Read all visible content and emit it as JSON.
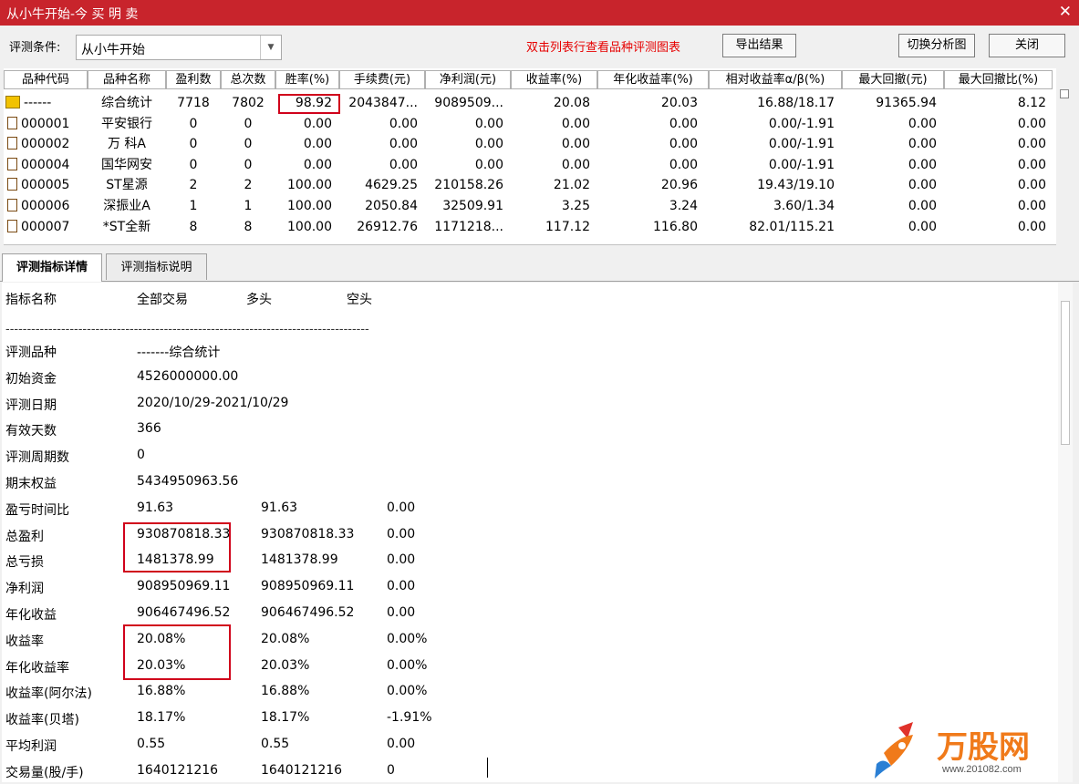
{
  "window": {
    "title": "从小牛开始-今 买 明 卖",
    "close_glyph": "✕"
  },
  "toolbar": {
    "condition_label": "评测条件:",
    "condition_value": "从小牛开始",
    "hint": "双击列表行查看品种评测图表",
    "export_label": "导出结果",
    "switch_label": "切换分析图",
    "close_label": "关闭"
  },
  "grid": {
    "columns": [
      "品种代码",
      "品种名称",
      "盈利数",
      "总次数",
      "胜率(%)",
      "手续费(元)",
      "净利润(元)",
      "收益率(%)",
      "年化收益率(%)",
      "相对收益率α/β(%)",
      "最大回撤(元)",
      "最大回撤比(%)"
    ],
    "rows": [
      {
        "code": "------",
        "name": "综合统计",
        "win": "7718",
        "total": "7802",
        "rate": "98.92",
        "fee": "2043847...",
        "profit": "9089509...",
        "ret": "20.08",
        "annual": "20.03",
        "alpha": "16.88/18.17",
        "dd": "91365.94",
        "ddr": "8.12"
      },
      {
        "code": "000001",
        "name": "平安银行",
        "win": "0",
        "total": "0",
        "rate": "0.00",
        "fee": "0.00",
        "profit": "0.00",
        "ret": "0.00",
        "annual": "0.00",
        "alpha": "0.00/-1.91",
        "dd": "0.00",
        "ddr": "0.00"
      },
      {
        "code": "000002",
        "name": "万 科A",
        "win": "0",
        "total": "0",
        "rate": "0.00",
        "fee": "0.00",
        "profit": "0.00",
        "ret": "0.00",
        "annual": "0.00",
        "alpha": "0.00/-1.91",
        "dd": "0.00",
        "ddr": "0.00"
      },
      {
        "code": "000004",
        "name": "国华网安",
        "win": "0",
        "total": "0",
        "rate": "0.00",
        "fee": "0.00",
        "profit": "0.00",
        "ret": "0.00",
        "annual": "0.00",
        "alpha": "0.00/-1.91",
        "dd": "0.00",
        "ddr": "0.00"
      },
      {
        "code": "000005",
        "name": "ST星源",
        "win": "2",
        "total": "2",
        "rate": "100.00",
        "fee": "4629.25",
        "profit": "210158.26",
        "ret": "21.02",
        "annual": "20.96",
        "alpha": "19.43/19.10",
        "dd": "0.00",
        "ddr": "0.00"
      },
      {
        "code": "000006",
        "name": "深振业A",
        "win": "1",
        "total": "1",
        "rate": "100.00",
        "fee": "2050.84",
        "profit": "32509.91",
        "ret": "3.25",
        "annual": "3.24",
        "alpha": "3.60/1.34",
        "dd": "0.00",
        "ddr": "0.00"
      },
      {
        "code": "000007",
        "name": "*ST全新",
        "win": "8",
        "total": "8",
        "rate": "100.00",
        "fee": "26912.76",
        "profit": "1171218...",
        "ret": "117.12",
        "annual": "116.80",
        "alpha": "82.01/115.21",
        "dd": "0.00",
        "ddr": "0.00"
      }
    ]
  },
  "tabs": [
    "评测指标详情",
    "评测指标说明"
  ],
  "detail": {
    "header": [
      "指标名称",
      "全部交易",
      "多头",
      "空头"
    ],
    "separator": "-------------------------------------------------------------------------------------",
    "rows": [
      {
        "label": "评测品种",
        "v1": "-------综合统计",
        "v2": "",
        "v3": ""
      },
      {
        "label": "初始资金",
        "v1": "4526000000.00",
        "v2": "",
        "v3": ""
      },
      {
        "label": "评测日期",
        "v1": "2020/10/29-2021/10/29",
        "v2": "",
        "v3": ""
      },
      {
        "label": "有效天数",
        "v1": "366",
        "v2": "",
        "v3": ""
      },
      {
        "label": "评测周期数",
        "v1": "0",
        "v2": "",
        "v3": ""
      },
      {
        "label": "期末权益",
        "v1": "5434950963.56",
        "v2": "",
        "v3": ""
      },
      {
        "label": "盈亏时间比",
        "v1": "91.63",
        "v2": "91.63",
        "v3": "0.00"
      },
      {
        "label": "总盈利",
        "v1": "930870818.33",
        "v2": "930870818.33",
        "v3": "0.00"
      },
      {
        "label": "总亏损",
        "v1": "1481378.99",
        "v2": "1481378.99",
        "v3": "0.00"
      },
      {
        "label": "净利润",
        "v1": "908950969.11",
        "v2": "908950969.11",
        "v3": "0.00"
      },
      {
        "label": "年化收益",
        "v1": "906467496.52",
        "v2": "906467496.52",
        "v3": "0.00"
      },
      {
        "label": "收益率",
        "v1": "20.08%",
        "v2": "20.08%",
        "v3": "0.00%"
      },
      {
        "label": "年化收益率",
        "v1": "20.03%",
        "v2": "20.03%",
        "v3": "0.00%"
      },
      {
        "label": "收益率(阿尔法)",
        "v1": "16.88%",
        "v2": "16.88%",
        "v3": "0.00%"
      },
      {
        "label": "收益率(贝塔)",
        "v1": "18.17%",
        "v2": "18.17%",
        "v3": "-1.91%"
      },
      {
        "label": "平均利润",
        "v1": "0.55",
        "v2": "0.55",
        "v3": "0.00"
      },
      {
        "label": "交易量(股/手)",
        "v1": "1640121216",
        "v2": "1640121216",
        "v3": "0"
      }
    ]
  },
  "watermark": {
    "brand": "万股网",
    "url": "www.201082.com"
  },
  "colors": {
    "titlebar": "#c8242c",
    "hint": "#e60000",
    "highlight_box": "#d0021b",
    "brand_orange": "#f07a1a"
  }
}
